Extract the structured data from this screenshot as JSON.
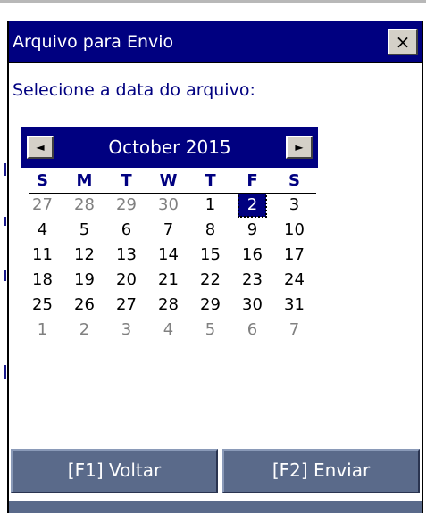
{
  "dialog": {
    "title": "Arquivo para Envio",
    "close_label": "×",
    "prompt": "Selecione a data do arquivo:"
  },
  "calendar": {
    "month_label": "October 2015",
    "prev_label": "◄",
    "next_label": "►",
    "weekdays": [
      "S",
      "M",
      "T",
      "W",
      "T",
      "F",
      "S"
    ],
    "selected_day": "2",
    "weeks": [
      [
        "27",
        "28",
        "29",
        "30",
        "1",
        "2",
        "3"
      ],
      [
        "4",
        "5",
        "6",
        "7",
        "8",
        "9",
        "10"
      ],
      [
        "11",
        "12",
        "13",
        "14",
        "15",
        "16",
        "17"
      ],
      [
        "18",
        "19",
        "20",
        "21",
        "22",
        "23",
        "24"
      ],
      [
        "25",
        "26",
        "27",
        "28",
        "29",
        "30",
        "31"
      ],
      [
        "1",
        "2",
        "3",
        "4",
        "5",
        "6",
        "7"
      ]
    ]
  },
  "buttons": {
    "back_label": "[F1] Voltar",
    "send_label": "[F2] Enviar"
  },
  "colors": {
    "title_bar": "#000080",
    "prompt_text": "#000080",
    "command_button": "#5a6a8a"
  }
}
